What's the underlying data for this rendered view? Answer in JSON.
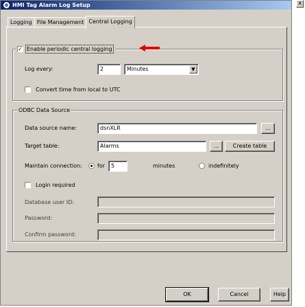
{
  "window": {
    "title": "HMI Tag Alarm Log Setup",
    "close_glyph": "x"
  },
  "tabs": [
    {
      "label": "Logging"
    },
    {
      "label": "File Management"
    },
    {
      "label": "Central Logging"
    }
  ],
  "central": {
    "enable_label": "Enable periodic central logging",
    "enable_checked": "✓",
    "log_every_label": "Log every:",
    "log_every_value": "2",
    "log_every_unit": "Minutes",
    "convert_label": "Convert time from local to UTC"
  },
  "odbc": {
    "group_title": "ODBC Data Source",
    "dsn_label": "Data source name:",
    "dsn_value": "dsnXLR",
    "browse_label": "...",
    "target_label": "Target table:",
    "target_value": "Alarms",
    "create_table_label": "Create table",
    "maintain_label": "Maintain connection:",
    "for_label": "for",
    "minutes_value": "5",
    "minutes_label": "minutes",
    "indefinitely_label": "indefinitely",
    "login_required_label": "Login required",
    "user_id_label": "Database user ID:",
    "password_label": "Password:",
    "confirm_label": "Confirm password:"
  },
  "footer": {
    "ok_label": "OK",
    "cancel_label": "Cancel",
    "help_label": "Help"
  },
  "colors": {
    "titlebar_start": "#0a246a",
    "titlebar_end": "#a6caf0",
    "annotation_arrow": "#e00000"
  }
}
